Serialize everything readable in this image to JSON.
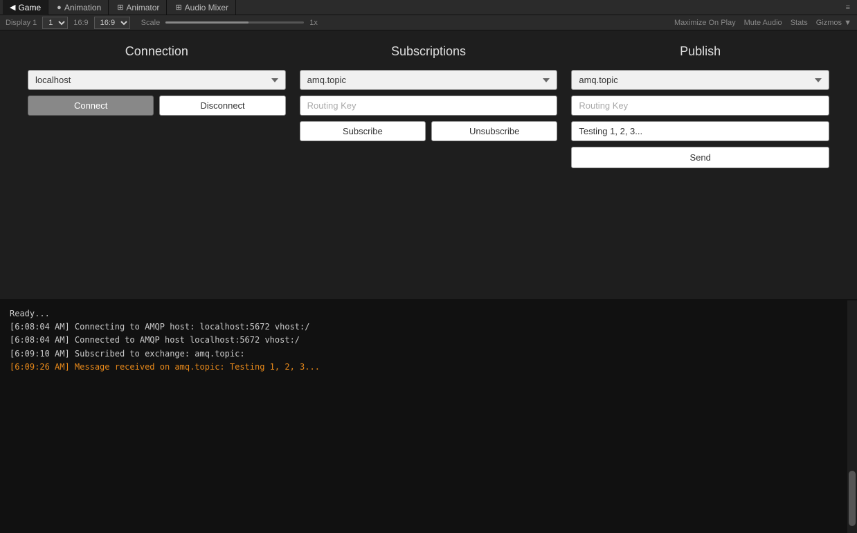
{
  "tabbar": {
    "tabs": [
      {
        "id": "game",
        "label": "Game",
        "icon": "◀",
        "active": true
      },
      {
        "id": "animation",
        "label": "Animation",
        "icon": "●"
      },
      {
        "id": "animator",
        "label": "Animator",
        "icon": "⊞"
      },
      {
        "id": "audiomixer",
        "label": "Audio Mixer",
        "icon": "⊞"
      }
    ],
    "menu_icon": "≡"
  },
  "secondbar": {
    "display_label": "Display 1",
    "ratio_label": "16:9",
    "scale_label": "Scale",
    "scale_value": "1x",
    "right_items": [
      "Maximize On Play",
      "Mute Audio",
      "Stats",
      "Gizmos ▼"
    ]
  },
  "connection": {
    "title": "Connection",
    "host_value": "localhost",
    "host_placeholder": "localhost",
    "connect_label": "Connect",
    "disconnect_label": "Disconnect"
  },
  "subscriptions": {
    "title": "Subscriptions",
    "exchange_value": "amq.topic",
    "routing_key_placeholder": "Routing Key",
    "subscribe_label": "Subscribe",
    "unsubscribe_label": "Unsubscribe"
  },
  "publish": {
    "title": "Publish",
    "exchange_value": "amq.topic",
    "routing_key_placeholder": "Routing Key",
    "message_value": "Testing 1, 2, 3...",
    "send_label": "Send"
  },
  "log": {
    "lines": [
      {
        "text": "Ready...",
        "type": "normal"
      },
      {
        "text": "[6:08:04 AM] Connecting to AMQP host: localhost:5672 vhost:/",
        "type": "normal"
      },
      {
        "text": "[6:08:04 AM] Connected to AMQP host localhost:5672 vhost:/",
        "type": "normal"
      },
      {
        "text": "[6:09:10 AM] Subscribed to exchange: amq.topic:",
        "type": "normal"
      },
      {
        "text": "[6:09:26 AM] Message received on amq.topic: Testing 1, 2, 3...",
        "type": "orange"
      }
    ]
  }
}
